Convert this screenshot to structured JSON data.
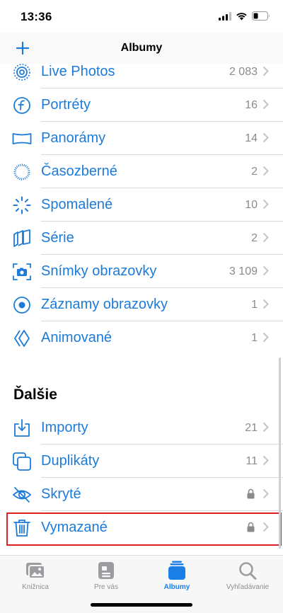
{
  "status": {
    "time": "13:36"
  },
  "nav": {
    "title": "Albumy",
    "add_icon": "plus-icon"
  },
  "media_types": [
    {
      "label": "Live Photos",
      "count": "2 083",
      "icon": "live-photo-icon"
    },
    {
      "label": "Portréty",
      "count": "16",
      "icon": "portrait-icon"
    },
    {
      "label": "Panorámy",
      "count": "14",
      "icon": "panorama-icon"
    },
    {
      "label": "Časozberné",
      "count": "2",
      "icon": "timelapse-icon"
    },
    {
      "label": "Spomalené",
      "count": "10",
      "icon": "slomo-icon"
    },
    {
      "label": "Série",
      "count": "2",
      "icon": "burst-icon"
    },
    {
      "label": "Snímky obrazovky",
      "count": "3 109",
      "icon": "screenshot-icon"
    },
    {
      "label": "Záznamy obrazovky",
      "count": "1",
      "icon": "screen-recording-icon"
    },
    {
      "label": "Animované",
      "count": "1",
      "icon": "animated-icon"
    }
  ],
  "other": {
    "title": "Ďalšie",
    "items": [
      {
        "label": "Importy",
        "count": "21",
        "icon": "import-icon"
      },
      {
        "label": "Duplikáty",
        "count": "11",
        "icon": "duplicates-icon"
      },
      {
        "label": "Skryté",
        "count": "",
        "icon": "hidden-eye-icon",
        "locked": true
      },
      {
        "label": "Vymazané",
        "count": "",
        "icon": "trash-icon",
        "locked": true
      }
    ]
  },
  "tabs": [
    {
      "label": "Knižnica",
      "icon": "library-icon",
      "active": false
    },
    {
      "label": "Pre vás",
      "icon": "for-you-icon",
      "active": false
    },
    {
      "label": "Albumy",
      "icon": "albums-icon",
      "active": true
    },
    {
      "label": "Vyhľadávanie",
      "icon": "search-icon",
      "active": false
    }
  ],
  "colors": {
    "accent": "#1c7bd9",
    "highlight": "#e02020",
    "secondary_text": "#8a8a8f"
  }
}
